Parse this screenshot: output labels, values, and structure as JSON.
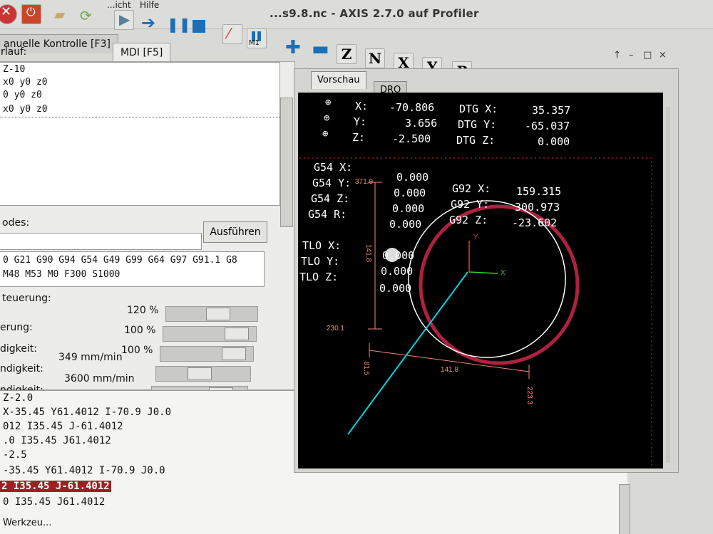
{
  "window": {
    "title": "...s9.8.nc - AXIS 2.7.0 auf Profiler",
    "menu": [
      "...icht",
      "Hilfe"
    ],
    "controls": [
      "↑",
      "–",
      "□",
      "×"
    ]
  },
  "toolbar": {
    "icons": [
      "estop-icon",
      "power-icon",
      "open-folder-icon",
      "reload-icon",
      "run-icon",
      "step-icon",
      "pause-icon",
      "stop-icon",
      "block-delete-icon",
      "optional-stop-icon"
    ],
    "view_icons": [
      "zoom-in-icon",
      "zoom-out-icon",
      "view-z-icon",
      "view-z2-icon",
      "view-x-icon",
      "view-y-icon",
      "view-p-icon",
      "rotate-icon",
      "clear-plot-icon"
    ],
    "view_letters": [
      "Z",
      "N",
      "X",
      "Y",
      "P"
    ],
    "m1_label": "M1"
  },
  "left_tabs": [
    "anuelle Kontrolle [F3]",
    "MDI [F5]"
  ],
  "mdi": {
    "history_label": "rlauf:",
    "history": [
      "Z-10",
      "x0 y0 z0",
      "0 y0 z0",
      "x0 y0 z0"
    ],
    "command_label": "odes:",
    "run_button": "Ausführen",
    "active_codes_1": "0 G21 G90 G94 G54 G49 G99 G64 G97 G91.1 G8",
    "active_codes_2": "M48 M53 M0 F300 S1000"
  },
  "overrides": {
    "heading": "teuerung:",
    "rows": [
      {
        "label": "",
        "value": "120 %",
        "fraction": 0.6
      },
      {
        "label": "erung:",
        "value": "100 %",
        "fraction": 0.9
      },
      {
        "label": "digkeit:",
        "value": "100 %",
        "fraction": 0.9
      },
      {
        "label": "ndigkeit:",
        "value": "349 mm/min",
        "fraction": 0.45
      },
      {
        "label": "ndigkeit:",
        "value": "3600 mm/min",
        "fraction": 0.8
      }
    ]
  },
  "gcode": {
    "lines": [
      "Z-2.0",
      "X-35.45 Y61.4012 I-70.9 J0.0",
      "012 I35.45 J-61.4012",
      ".0 I35.45 J61.4012",
      "-2.5",
      "-35.45 Y61.4012 I-70.9 J0.0",
      "2 I35.45 J-61.4012",
      "0 I35.45 J61.4012"
    ],
    "highlighted_index": 6,
    "footer": "Werkzeu..."
  },
  "preview_tabs": [
    "Vorschau",
    "DRO"
  ],
  "dro": {
    "pos": [
      {
        "axis": "X:",
        "value": "-70.806",
        "dtg_label": "DTG X:",
        "dtg": "35.357"
      },
      {
        "axis": "Y:",
        "value": "3.656",
        "dtg_label": "DTG Y:",
        "dtg": "-65.037"
      },
      {
        "axis": "Z:",
        "value": "-2.500",
        "dtg_label": "DTG Z:",
        "dtg": "0.000"
      }
    ],
    "g54": [
      {
        "label": "G54 X:",
        "value": "0.000"
      },
      {
        "label": "G54 Y:",
        "value": "0.000"
      },
      {
        "label": "G54 Z:",
        "value": "0.000"
      },
      {
        "label": "G54 R:",
        "value": "0.000"
      }
    ],
    "g92": [
      {
        "label": "G92 X:",
        "value": "159.315"
      },
      {
        "label": "G92 Y:",
        "value": "300.973"
      },
      {
        "label": "G92 Z:",
        "value": "-23.602"
      }
    ],
    "tlo": [
      {
        "label": "TLO X:",
        "value": "0.000"
      },
      {
        "label": "TLO Y:",
        "value": "0.000"
      },
      {
        "label": "TLO Z:",
        "value": "0.000"
      }
    ]
  },
  "dimensions": {
    "y_top": "371.9",
    "y_height": "141.8",
    "y_bottom": "230.1",
    "x_left": "81.5",
    "x_width": "141.8",
    "x_right": "223.3"
  },
  "axis_labels": {
    "x": "X",
    "y": "Y"
  },
  "colors": {
    "feed_path": "#ffffff",
    "traverse": "#00d5e0",
    "done_path": "#b02040",
    "limits": "#e04040",
    "dims": "#f08a7a",
    "highlight": "#9a2225"
  }
}
